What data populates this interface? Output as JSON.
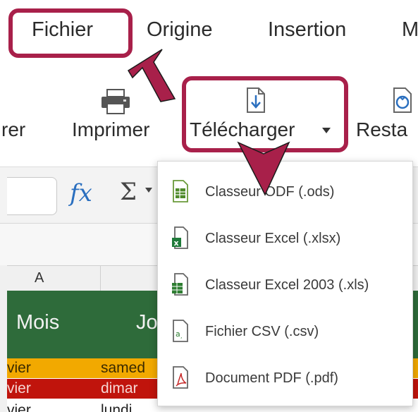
{
  "menubar": {
    "items": [
      {
        "label": "Fichier"
      },
      {
        "label": "Origine"
      },
      {
        "label": "Insertion"
      },
      {
        "label": "M"
      }
    ]
  },
  "ribbon": {
    "partial_left_label": "rer",
    "print_label": "Imprimer",
    "download_label": "Télécharger",
    "restore_partial_label": "Resta"
  },
  "formula_bar": {
    "fx_symbol": "fx",
    "sum_symbol": "Σ"
  },
  "sheet": {
    "column_header_a": "A",
    "header_row": {
      "col1": "Mois",
      "col2": "Jo"
    },
    "rows": [
      {
        "c1": "vier",
        "c2": "samed",
        "color": "#f2a900"
      },
      {
        "c1": "vier",
        "c2": "dimar",
        "color": "#c0140c"
      },
      {
        "c1": "vier",
        "c2": "lundi",
        "color": "#ffffff"
      }
    ],
    "header_color": "#2e6b3a"
  },
  "download_menu": {
    "items": [
      {
        "label": "Classeur ODF (.ods)",
        "icon": "ods-file-icon"
      },
      {
        "label": "Classeur Excel (.xlsx)",
        "icon": "xlsx-file-icon"
      },
      {
        "label": "Classeur Excel 2003 (.xls)",
        "icon": "xls-file-icon"
      },
      {
        "label": "Fichier CSV (.csv)",
        "icon": "csv-file-icon"
      },
      {
        "label": "Document PDF (.pdf)",
        "icon": "pdf-file-icon"
      }
    ]
  },
  "annotation_color": "#a8204a"
}
